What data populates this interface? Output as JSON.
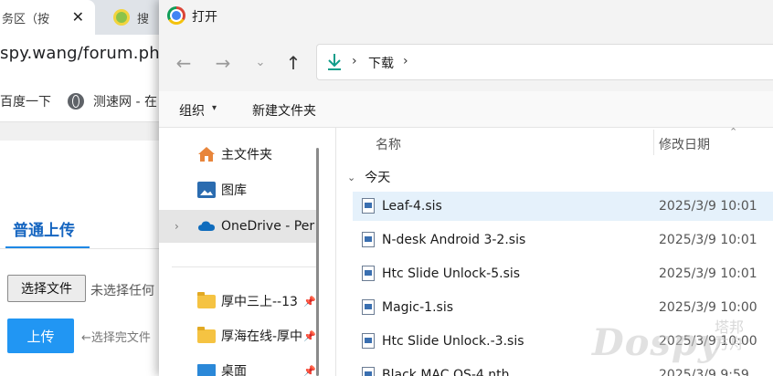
{
  "browser": {
    "tabs": [
      {
        "title": "务区（按",
        "close": "✕"
      },
      {
        "title": "搜"
      }
    ],
    "url": "spy.wang/forum.ph",
    "bookmarks": [
      "百度一下",
      "测速网 - 在"
    ],
    "page": {
      "tab_label": "普通上传",
      "choose_file_label": "选择文件",
      "no_file_text": "未选择任何",
      "upload_label": "上传",
      "upload_hint": "←选择完文件"
    }
  },
  "dialog": {
    "title": "打开",
    "nav": {
      "back": "←",
      "forward": "→",
      "recent": "⌄",
      "up": "↑"
    },
    "path": {
      "separator": "›",
      "folder": "下载"
    },
    "commands": {
      "organize": "组织",
      "organize_caret": "▾",
      "new_folder": "新建文件夹"
    },
    "nav_pane": {
      "home": "主文件夹",
      "gallery": "图库",
      "onedrive": "OneDrive - Per",
      "pinned": [
        {
          "label": "厚中三上--13"
        },
        {
          "label": "厚海在线-厚中"
        },
        {
          "label": "桌面"
        }
      ],
      "expander": "›",
      "pin": "📌"
    },
    "columns": {
      "name": "名称",
      "date": "修改日期",
      "sort": "⌃"
    },
    "group": {
      "label": "今天",
      "caret": "⌄"
    },
    "files": [
      {
        "name": "Leaf-4.sis",
        "date": "2025/3/9 10:01",
        "selected": true
      },
      {
        "name": "N-desk Android 3-2.sis",
        "date": "2025/3/9 10:01"
      },
      {
        "name": "Htc Slide Unlock-5.sis",
        "date": "2025/3/9 10:01"
      },
      {
        "name": "Magic-1.sis",
        "date": "2025/3/9 10:00"
      },
      {
        "name": "Htc Slide Unlock.-3.sis",
        "date": "2025/3/9 10:00"
      },
      {
        "name": "Black MAC OS-4.nth",
        "date": "2025/3/9 9:59"
      }
    ]
  },
  "watermark": {
    "brand": "Dospy",
    "sub": "塔邦方舟"
  }
}
